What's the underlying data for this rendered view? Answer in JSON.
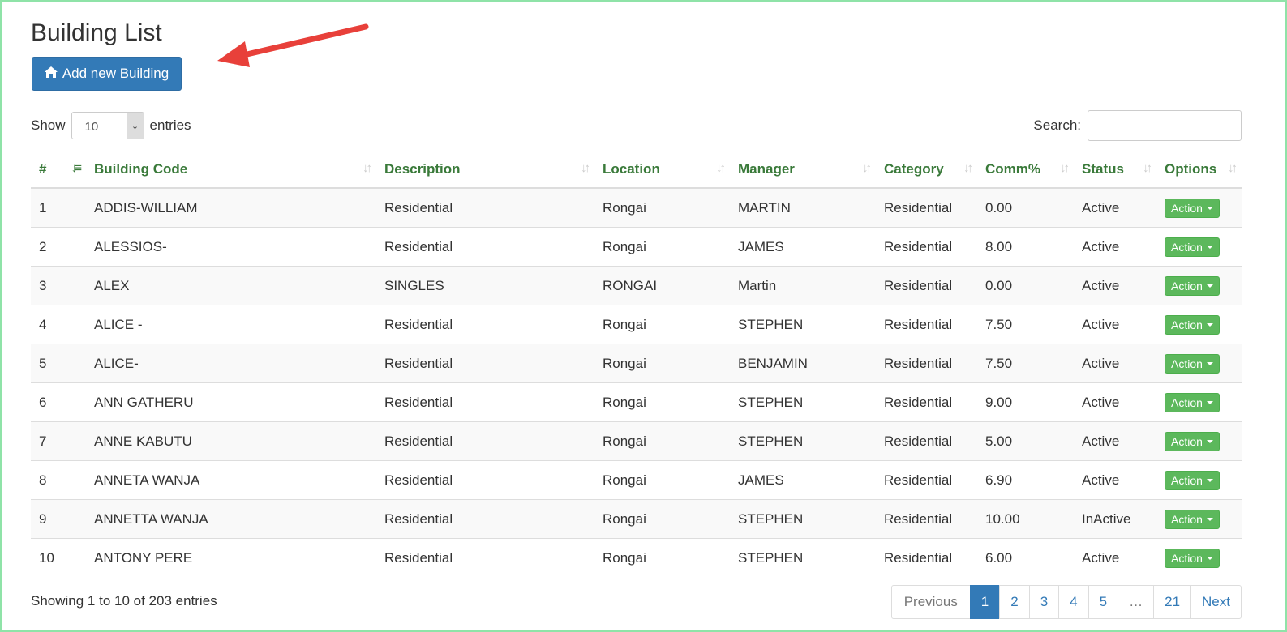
{
  "page": {
    "title": "Building List"
  },
  "toolbar": {
    "add_label": "Add new Building",
    "add_icon": "home-icon"
  },
  "length": {
    "show_label": "Show",
    "value": "10",
    "entries_label": "entries"
  },
  "search": {
    "label": "Search:",
    "value": ""
  },
  "table": {
    "columns": [
      "#",
      "Building Code",
      "Description",
      "Location",
      "Manager",
      "Category",
      "Comm%",
      "Status",
      "Options"
    ],
    "rows": [
      [
        "1",
        "ADDIS-WILLIAM",
        "Residential",
        "Rongai",
        "MARTIN",
        "Residential",
        "0.00",
        "Active",
        "Action"
      ],
      [
        "2",
        "ALESSIOS-",
        "Residential",
        "Rongai",
        "JAMES",
        "Residential",
        "8.00",
        "Active",
        "Action"
      ],
      [
        "3",
        "ALEX",
        "SINGLES",
        "RONGAI",
        "Martin",
        "Residential",
        "0.00",
        "Active",
        "Action"
      ],
      [
        "4",
        "ALICE -",
        "Residential",
        "Rongai",
        "STEPHEN",
        "Residential",
        "7.50",
        "Active",
        "Action"
      ],
      [
        "5",
        "ALICE-",
        "Residential",
        "Rongai",
        "BENJAMIN",
        "Residential",
        "7.50",
        "Active",
        "Action"
      ],
      [
        "6",
        "ANN GATHERU",
        "Residential",
        "Rongai",
        "STEPHEN",
        "Residential",
        "9.00",
        "Active",
        "Action"
      ],
      [
        "7",
        "ANNE KABUTU",
        "Residential",
        "Rongai",
        "STEPHEN",
        "Residential",
        "5.00",
        "Active",
        "Action"
      ],
      [
        "8",
        "ANNETA WANJA",
        "Residential",
        "Rongai",
        "JAMES",
        "Residential",
        "6.90",
        "Active",
        "Action"
      ],
      [
        "9",
        "ANNETTA WANJA",
        "Residential",
        "Rongai",
        "STEPHEN",
        "Residential",
        "10.00",
        "InActive",
        "Action"
      ],
      [
        "10",
        "ANTONY PERE",
        "Residential",
        "Rongai",
        "STEPHEN",
        "Residential",
        "6.00",
        "Active",
        "Action"
      ]
    ]
  },
  "footer": {
    "info": "Showing 1 to 10 of 203 entries",
    "pagination": [
      "Previous",
      "1",
      "2",
      "3",
      "4",
      "5",
      "…",
      "21",
      "Next"
    ],
    "active_page": "1"
  },
  "colors": {
    "primary": "#337ab7",
    "success": "#5cb85c",
    "header_text": "#3a7a3a",
    "arrow": "#e8403a"
  }
}
